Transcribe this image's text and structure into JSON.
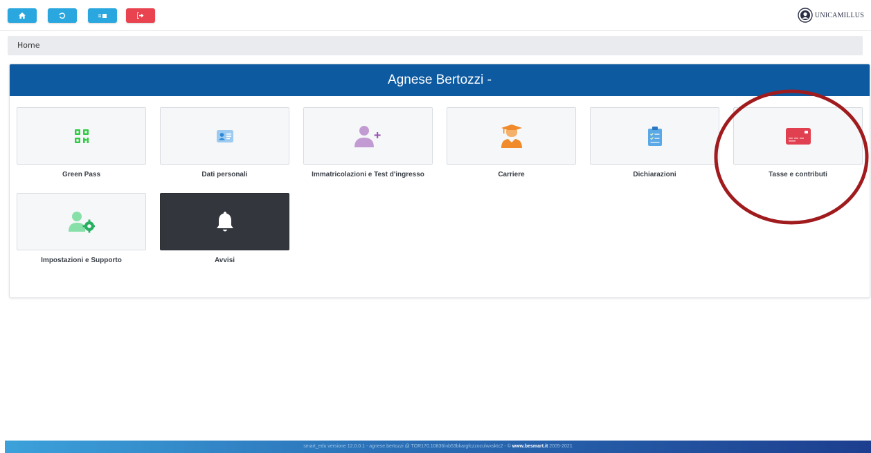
{
  "toolbar": {
    "buttons": [
      {
        "icon": "home-icon",
        "color": "#2aa7df"
      },
      {
        "icon": "history-icon",
        "color": "#2aa7df"
      },
      {
        "icon": "switch-icon",
        "color": "#2aa7df"
      },
      {
        "icon": "logout-icon",
        "color": "#e8434f"
      }
    ]
  },
  "brand": {
    "name": "UNICAMILLUS"
  },
  "breadcrumb": {
    "home": "Home"
  },
  "card": {
    "title": "Agnese Bertozzi -"
  },
  "tiles": [
    {
      "label": "Green Pass",
      "icon": "qr-code-icon",
      "color": "#2ecc40"
    },
    {
      "label": "Dati personali",
      "icon": "id-card-icon",
      "color": "#5aa9e6"
    },
    {
      "label": "Immatricolazioni e Test d'ingresso",
      "icon": "add-user-icon",
      "color": "#c39bd3"
    },
    {
      "label": "Carriere",
      "icon": "graduate-icon",
      "color": "#f08a2a"
    },
    {
      "label": "Dichiarazioni",
      "icon": "clipboard-check-icon",
      "color": "#5aa9e6"
    },
    {
      "label": "Tasse e contributi",
      "icon": "credit-card-icon",
      "color": "#e0404f"
    },
    {
      "label": "Impostazioni e Supporto",
      "icon": "user-settings-icon",
      "color": "#5fd38d"
    },
    {
      "label": "Avvisi",
      "icon": "bell-icon",
      "color": "#ffffff"
    }
  ],
  "annotation": {
    "color": "#a01b1e"
  },
  "footer": {
    "text": "smart_edu versione 12.0.0.1 - agnese.bertozzi @ TOR170.10836/nb53bkargfczzozulwxsktc2 - ©",
    "link": "www.besmart.it",
    "years": "2005-2021"
  }
}
